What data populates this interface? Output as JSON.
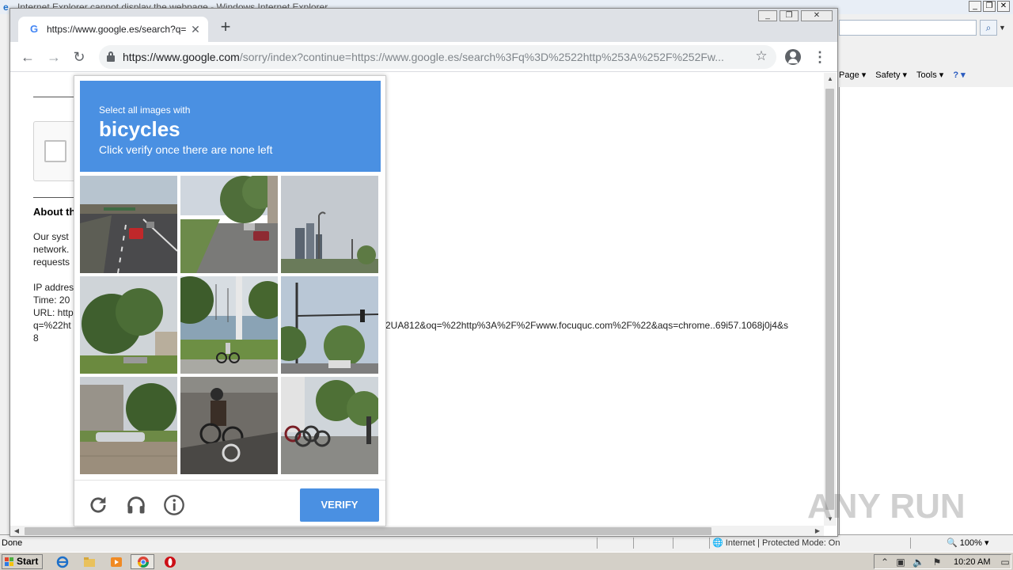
{
  "ie": {
    "title": "Internet Explorer cannot display the webpage - Windows Internet Explorer",
    "command_bar": {
      "page": "Page",
      "safety": "Safety",
      "tools": "Tools",
      "help": "?"
    },
    "status": {
      "done": "Done",
      "zone": "Internet | Protected Mode: On",
      "zoom": "100%"
    }
  },
  "chrome": {
    "tab": {
      "title": "https://www.google.es/search?q=%",
      "favicon": "G"
    },
    "omnibox": {
      "host": "https://www.google.com",
      "path": "/sorry/index?continue=https://www.google.es/search%3Fq%3D%2522http%253A%252F%252Fw..."
    }
  },
  "page": {
    "heading": "About th",
    "lines": [
      "Our syst",
      "network.",
      "requests",
      "",
      "IP addres",
      "Time: 20",
      "URL: http",
      "q=%22ht",
      "8"
    ],
    "url_tail": "2UA812&oq=%22http%3A%2F%2Fwww.focuquc.com%2F%22&aqs=chrome..69i57.1068j0j4&s"
  },
  "captcha": {
    "instruction": "Select all images with",
    "target": "bicycles",
    "subinstruction": "Click verify once there are none left",
    "verify_label": "VERIFY",
    "tiles": [
      {
        "scene": "highway-overpass"
      },
      {
        "scene": "street-trees-cars"
      },
      {
        "scene": "city-skyline-streetlight"
      },
      {
        "scene": "trees-houses"
      },
      {
        "scene": "harbor-cyclist"
      },
      {
        "scene": "intersection-traffic-light"
      },
      {
        "scene": "house-fence-car"
      },
      {
        "scene": "cyclist-street"
      },
      {
        "scene": "parked-bicycles"
      }
    ]
  },
  "watermark": "ANY RUN",
  "taskbar": {
    "start": "Start",
    "clock": "10:20 AM"
  },
  "colors": {
    "captcha_blue": "#4a90e2",
    "chrome_strip": "#dee1e6"
  }
}
